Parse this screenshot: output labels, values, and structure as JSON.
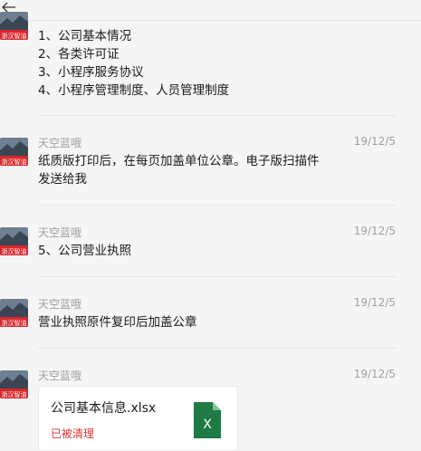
{
  "messages": [
    {
      "lines": [
        "1、公司基本情况",
        "2、各类许可证",
        "3、小程序服务协议",
        "4、小程序管理制度、人员管理制度"
      ]
    },
    {
      "sender": "天空蓝哦",
      "time": "19/12/5",
      "lines": [
        "纸质版打印后，在每页加盖单位公章。电子版扫描件",
        "发送给我"
      ]
    },
    {
      "sender": "天空蓝哦",
      "time": "19/12/5",
      "lines": [
        "5、公司营业执照"
      ]
    },
    {
      "sender": "天空蓝哦",
      "time": "19/12/5",
      "lines": [
        "营业执照原件复印后加盖公章"
      ]
    },
    {
      "sender": "天空蓝哦",
      "time": "19/12/5",
      "file": {
        "name": "公司基本信息.xlsx",
        "status": "已被清理",
        "icon_letter": "X"
      }
    }
  ],
  "avatar_badge": "浙汉智油",
  "icons": {
    "back": "back-arrow-icon",
    "file": "excel-file-icon"
  },
  "colors": {
    "status_red": "#d93636",
    "excel_green": "#1f7a44",
    "muted_text": "#a0a0a0"
  }
}
